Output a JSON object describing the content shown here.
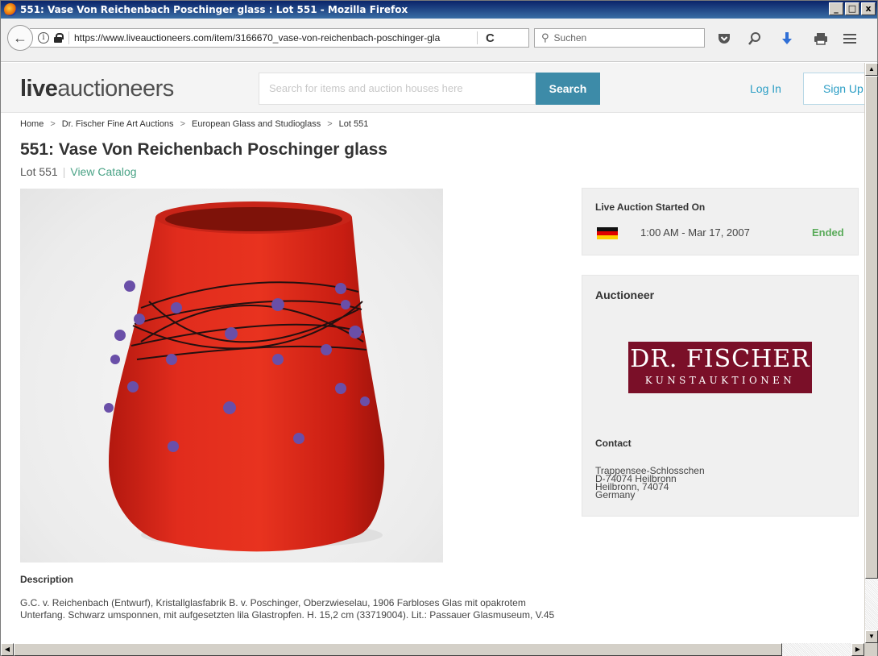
{
  "window": {
    "title": "551: Vase Von Reichenbach Poschinger glass : Lot 551 - Mozilla Firefox",
    "min": "_",
    "max": "□",
    "close": "x"
  },
  "browser": {
    "url": "https://www.liveauctioneers.com/item/3166670_vase-von-reichenbach-poschinger-gla",
    "search_placeholder": "Suchen"
  },
  "site": {
    "logo_bold": "live",
    "logo_light": "auctioneers",
    "search_placeholder": "Search for items and auction houses here",
    "search_button": "Search",
    "login": "Log In",
    "signup": "Sign Up"
  },
  "breadcrumb": [
    "Home",
    "Dr. Fischer Fine Art Auctions",
    "European Glass and Studioglass",
    "Lot 551"
  ],
  "breadcrumb_sep": ">",
  "lot": {
    "title": "551: Vase Von Reichenbach Poschinger glass",
    "lot_label": "Lot 551",
    "view_catalog": "View Catalog"
  },
  "auction": {
    "heading": "Live Auction Started On",
    "date": "1:00 AM - Mar 17, 2007",
    "status": "Ended",
    "status_color": "#5aab5a"
  },
  "auctioneer": {
    "heading": "Auctioneer",
    "logo_line1": "DR. FISCHER",
    "logo_line2": "KUNSTAUKTIONEN",
    "logo_color": "#7a0f28",
    "contact_heading": "Contact",
    "contact_lines": [
      "Trappensee-Schlosschen",
      "D-74074 Heilbronn",
      "Heilbronn, 74074",
      "Germany"
    ]
  },
  "description": {
    "heading": "Description",
    "text": "G.C. v. Reichenbach (Entwurf), Kristallglasfabrik B. v. Poschinger, Oberzwieselau, 1906 Farbloses Glas mit opakrotem Unterfang. Schwarz umsponnen, mit aufgesetzten lila Glastropfen. H. 15,2 cm (33719004). Lit.: Passauer Glasmuseum, V.45"
  },
  "colors": {
    "accent": "#3d8ba8",
    "link": "#2c9ec5",
    "catalog_link": "#4aa386",
    "vase_red": "#e0261a"
  }
}
